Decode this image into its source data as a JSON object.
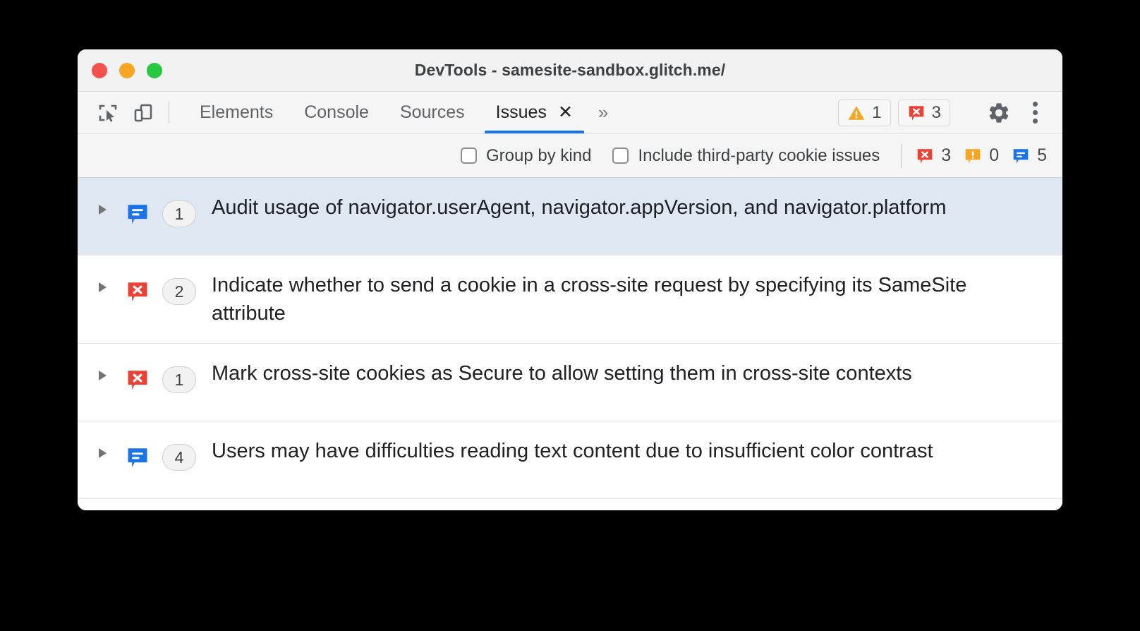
{
  "window": {
    "title": "DevTools - samesite-sandbox.glitch.me/",
    "traffic_lights": {
      "close_color": "#f4524d",
      "minimize_color": "#f6a623",
      "maximize_color": "#28c840"
    }
  },
  "toolbar": {
    "inspect_icon": "inspect-element-icon",
    "device_icon": "device-toolbar-icon",
    "tabs": [
      {
        "label": "Elements",
        "active": false,
        "closable": false
      },
      {
        "label": "Console",
        "active": false,
        "closable": false
      },
      {
        "label": "Sources",
        "active": false,
        "closable": false
      },
      {
        "label": "Issues",
        "active": true,
        "closable": true
      }
    ],
    "close_glyph": "✕",
    "overflow_glyph": "»",
    "warning_count": "1",
    "error_count": "3",
    "gear_icon": "gear-icon",
    "kebab_icon": "more-options-icon",
    "accent_color": "#1a73e8"
  },
  "filterbar": {
    "group_by_kind": {
      "label": "Group by kind",
      "checked": false
    },
    "include_third_party": {
      "label": "Include third-party cookie issues",
      "checked": false
    },
    "severity": {
      "error": {
        "count": "3",
        "color": "#ea4335"
      },
      "warning": {
        "count": "0",
        "color": "#f5a623"
      },
      "info": {
        "count": "5",
        "color": "#1a73e8"
      }
    }
  },
  "issues": [
    {
      "kind": "info",
      "count": "1",
      "text": "Audit usage of navigator.userAgent, navigator.appVersion, and navigator.platform",
      "selected": true
    },
    {
      "kind": "error",
      "count": "2",
      "text": "Indicate whether to send a cookie in a cross-site request by specifying its SameSite attribute",
      "selected": false
    },
    {
      "kind": "error",
      "count": "1",
      "text": "Mark cross-site cookies as Secure to allow setting them in cross-site contexts",
      "selected": false
    },
    {
      "kind": "info",
      "count": "4",
      "text": "Users may have difficulties reading text content due to insufficient color contrast",
      "selected": false
    }
  ]
}
